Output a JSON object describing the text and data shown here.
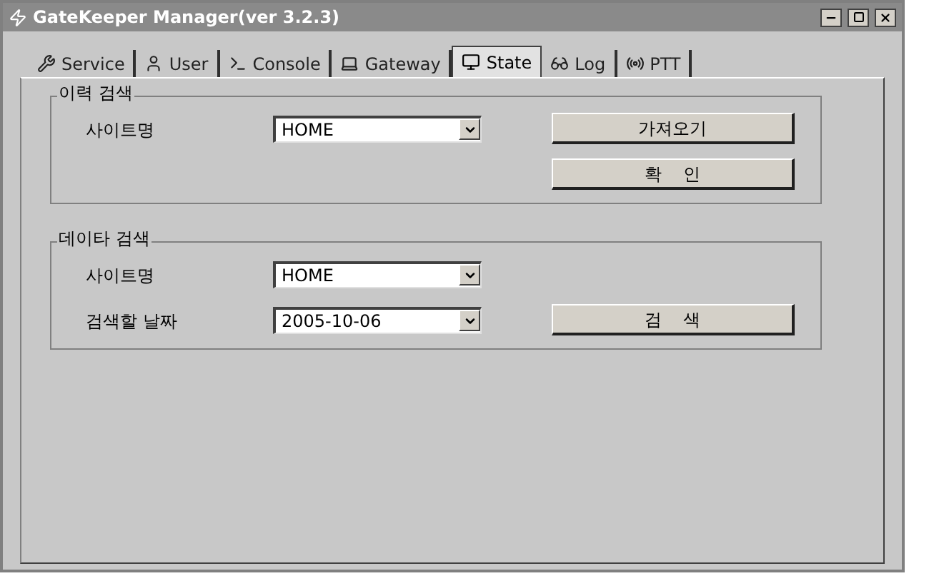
{
  "window": {
    "title": "GateKeeper Manager(ver 3.2.3)"
  },
  "tabs": [
    {
      "label": "Service",
      "selected": false
    },
    {
      "label": "User",
      "selected": false
    },
    {
      "label": "Console",
      "selected": false
    },
    {
      "label": "Gateway",
      "selected": false
    },
    {
      "label": "State",
      "selected": true
    },
    {
      "label": "Log",
      "selected": false
    },
    {
      "label": "PTT",
      "selected": false
    }
  ],
  "groups": [
    {
      "title": "이력 검색",
      "rows": [
        {
          "label": "사이트명",
          "value": "HOME",
          "button": "가져오기"
        },
        {
          "button": "확    인"
        }
      ]
    },
    {
      "title": "데이타 검색",
      "rows": [
        {
          "label": "사이트명",
          "value": "HOME"
        },
        {
          "label": "검색할 날짜",
          "value": "2005-10-06",
          "button": "검    색"
        }
      ]
    }
  ]
}
